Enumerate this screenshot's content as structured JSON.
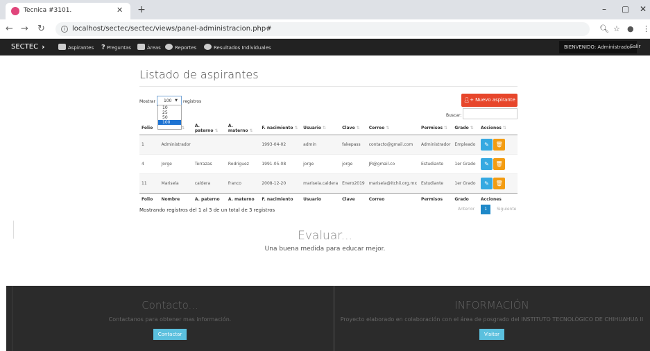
{
  "browser": {
    "tab_title": "Tecnica #3101.",
    "url": "localhost/sectec/sectec/views/panel-administracion.php#"
  },
  "nav": {
    "brand": "SECTEC",
    "items": [
      "Aspirantes",
      "Preguntas",
      "Áreas",
      "Reportes",
      "Resultados Individuales"
    ],
    "welcome": "BIENVENIDO: Administrador",
    "logout": "Salir"
  },
  "page": {
    "title": "Listado de aspirantes",
    "show_label": "Mostrar",
    "page_size": "100",
    "page_size_options": [
      "10",
      "25",
      "50",
      "100"
    ],
    "records_label": "registros",
    "new_button": "Nuevo aspirante",
    "search_label": "Buscar:"
  },
  "table": {
    "columns": [
      "Folio",
      "Nombre",
      "A. paterno",
      "A. materno",
      "F. nacimiento",
      "Usuario",
      "Clave",
      "Correo",
      "Permisos",
      "Grado",
      "Acciones"
    ],
    "rows": [
      [
        "1",
        "Administrador",
        "",
        "",
        "1993-04-02",
        "admin",
        "fakepass",
        "contacto@gmail.com",
        "Administrador",
        "Empleado"
      ],
      [
        "4",
        "Jorge",
        "Terrazas",
        "Rodriguez",
        "1991-05-08",
        "jorge",
        "jorge",
        "JR@gmail.co",
        "Estudiante",
        "1er Grado"
      ],
      [
        "11",
        "Marisela",
        "caldera",
        "franco",
        "2008-12-20",
        "marisela.caldera",
        "Enero2019",
        "marisela@itchii.org.mx",
        "Estudiante",
        "1er Grado"
      ]
    ]
  },
  "pagination": {
    "info": "Mostrando registros del 1 al 3 de un total de 3 registros",
    "prev": "Anterior",
    "current": "1",
    "next": "Siguiente"
  },
  "hero": {
    "title": "Evaluar...",
    "subtitle": "Una buena medida para educar mejor."
  },
  "footer": {
    "contact_title": "Contacto...",
    "contact_text": "Contactanos para obtener mas información.",
    "contact_button": "Contactar",
    "info_title": "INFORMACIÓN",
    "info_text": "Proyecto elaborado en colaboración con el área de posgrado del INSTITUTO TECNOLÓGICO DE CHIHUAHUA II",
    "info_button": "Visitar"
  }
}
